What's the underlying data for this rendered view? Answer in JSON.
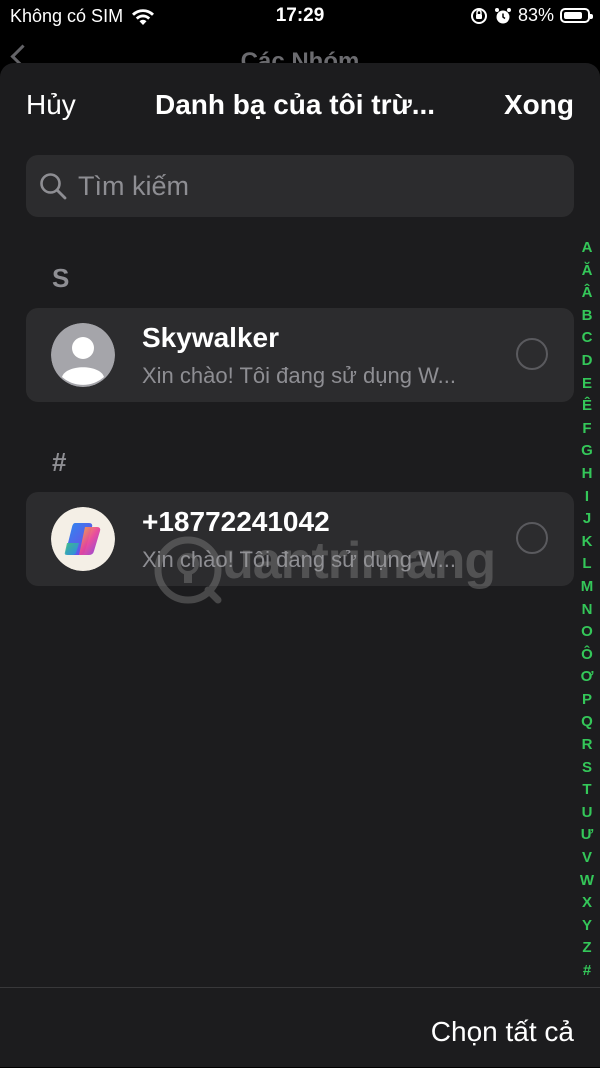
{
  "status": {
    "carrier": "Không có SIM",
    "time": "17:29",
    "battery": "83%",
    "battery_level": 0.83
  },
  "background": {
    "title": "Các Nhóm"
  },
  "nav": {
    "cancel": "Hủy",
    "title": "Danh bạ của tôi trừ...",
    "done": "Xong"
  },
  "search": {
    "placeholder": "Tìm kiếm"
  },
  "sections": [
    {
      "header": "S",
      "contacts": [
        {
          "name": "Skywalker",
          "subtitle": "Xin chào! Tôi đang sử dụng W...",
          "avatar": "default-person-icon"
        }
      ]
    },
    {
      "header": "#",
      "contacts": [
        {
          "name": "+18772241042",
          "subtitle": "Xin chào! Tôi đang sử dụng W...",
          "avatar": "copilot-logo-icon"
        }
      ]
    }
  ],
  "index_letters": [
    "A",
    "Ă",
    "Â",
    "B",
    "C",
    "D",
    "E",
    "Ê",
    "F",
    "G",
    "H",
    "I",
    "J",
    "K",
    "L",
    "M",
    "N",
    "O",
    "Ô",
    "Ơ",
    "P",
    "Q",
    "R",
    "S",
    "T",
    "U",
    "Ư",
    "V",
    "W",
    "X",
    "Y",
    "Z",
    "#"
  ],
  "bottom": {
    "select_all": "Chọn tất cả"
  },
  "watermark": "uantrimang",
  "colors": {
    "accent": "#34c759",
    "sheet": "#1c1c1e",
    "card": "#2c2c2e",
    "secondary_text": "#8e8e93"
  }
}
